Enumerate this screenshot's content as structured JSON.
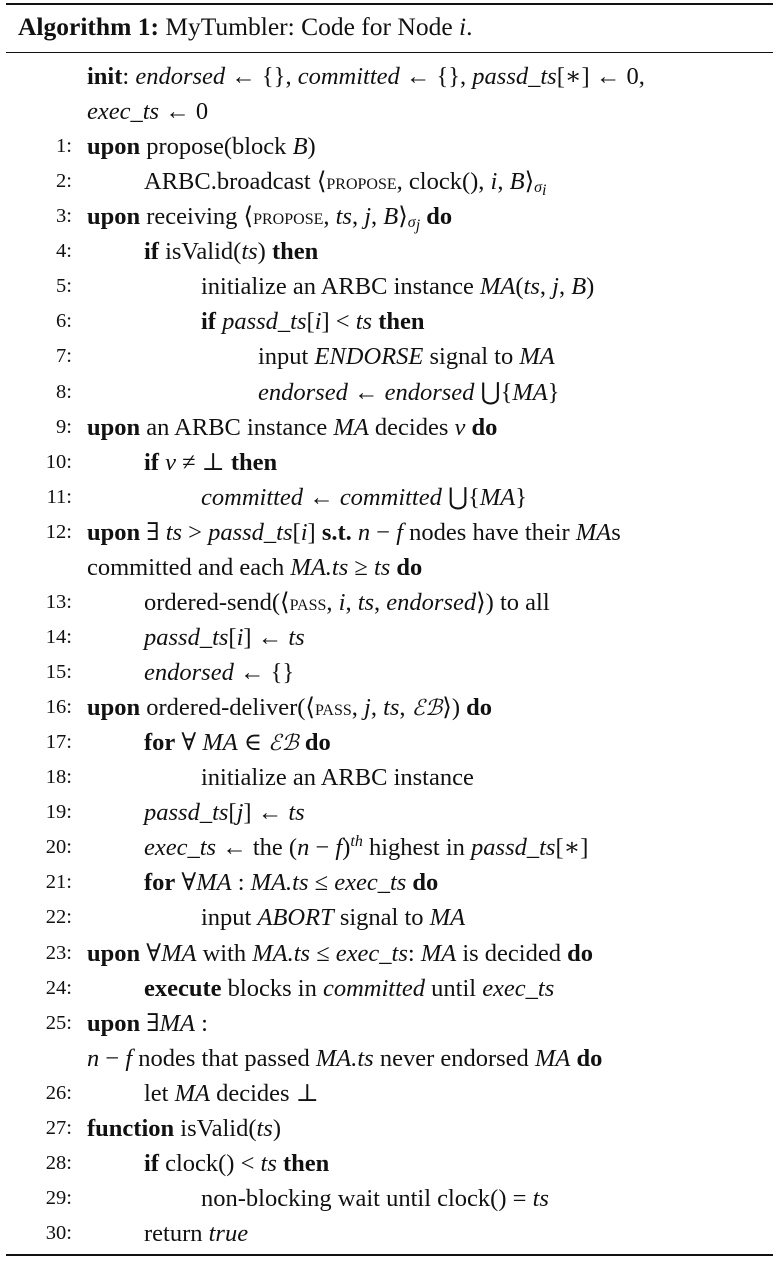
{
  "caption": {
    "label": "Algorithm 1:",
    "title": "MyTumbler: Code for Node i."
  },
  "lines": [
    {
      "num": "",
      "indent": 0,
      "html": "<b>init</b>: <i>endorsed</i> ← {}, <i>committed</i> ← {}, <i>passd_ts</i>[∗] ← 0,"
    },
    {
      "num": "",
      "indent": 0,
      "html": "<i>exec_ts</i> ← 0"
    },
    {
      "num": "1:",
      "indent": 0,
      "html": "<b>upon</b> propose(block <i>B</i>)"
    },
    {
      "num": "2:",
      "indent": 1,
      "html": "ARBC.broadcast ⟨<span class=\"sc\">propose</span>, clock(), <i>i</i>, <i>B</i>⟩<sub><i>σ<sub>i</sub></i></sub>"
    },
    {
      "num": "3:",
      "indent": 0,
      "html": "<b>upon</b> receiving ⟨<span class=\"sc\">propose</span>, <i>ts</i>, <i>j</i>, <i>B</i>⟩<sub><i>σ<sub>j</sub></i></sub> <b>do</b>"
    },
    {
      "num": "4:",
      "indent": 1,
      "html": "<b>if</b> isValid(<i>ts</i>) <b>then</b>"
    },
    {
      "num": "5:",
      "indent": 2,
      "html": "initialize an ARBC instance <i>MA</i>(<i>ts</i>, <i>j</i>, <i>B</i>)"
    },
    {
      "num": "6:",
      "indent": 2,
      "html": "<b>if</b> <i>passd_ts</i>[<i>i</i>] &lt; <i>ts</i> <b>then</b>"
    },
    {
      "num": "7:",
      "indent": 3,
      "html": "input <i>ENDORSE</i> signal to <i>MA</i>"
    },
    {
      "num": "8:",
      "indent": 3,
      "html": "<i>endorsed</i> ← <i>endorsed</i> ⋃{<i>MA</i>}"
    },
    {
      "num": "9:",
      "indent": 0,
      "html": "<b>upon</b> an ARBC instance <i>MA</i> decides <i>v</i> <b>do</b>"
    },
    {
      "num": "10:",
      "indent": 1,
      "html": "<b>if</b> <i>v</i> ≠ ⊥ <b>then</b>"
    },
    {
      "num": "11:",
      "indent": 2,
      "html": "<i>committed</i> ← <i>committed</i> ⋃{<i>MA</i>}"
    },
    {
      "num": "12:",
      "indent": 0,
      "html": "<b>upon</b> ∃ <i>ts</i> &gt; <i>passd_ts</i>[<i>i</i>] <b>s.t.</b> <i>n</i> − <i>f</i> nodes have their <i>MA</i>s"
    },
    {
      "num": "",
      "indent": 0,
      "html": "committed and each <i>MA.ts</i> ≥ <i>ts</i> <b>do</b>"
    },
    {
      "num": "13:",
      "indent": 1,
      "html": "ordered-send(⟨<span class=\"sc\">pass</span>, <i>i</i>, <i>ts</i>, <i>endorsed</i>⟩) to all"
    },
    {
      "num": "14:",
      "indent": 1,
      "html": "<i>passd_ts</i>[<i>i</i>] ← <i>ts</i>"
    },
    {
      "num": "15:",
      "indent": 1,
      "html": "<i>endorsed</i> ← {}"
    },
    {
      "num": "16:",
      "indent": 0,
      "html": "<b>upon</b> ordered-deliver(⟨<span class=\"sc\">pass</span>, <i>j</i>, <i>ts</i>, <span class=\"cal\">ℰℬ</span>⟩) <b>do</b>"
    },
    {
      "num": "17:",
      "indent": 1,
      "html": "<b>for</b> ∀ <i>MA</i> ∈ <span class=\"cal\">ℰℬ</span> <b>do</b>"
    },
    {
      "num": "18:",
      "indent": 2,
      "html": "initialize an ARBC instance"
    },
    {
      "num": "19:",
      "indent": 1,
      "html": "<i>passd_ts</i>[<i>j</i>] ← <i>ts</i>"
    },
    {
      "num": "20:",
      "indent": 1,
      "html": "<i>exec_ts</i> ← the (<i>n</i> − <i>f</i>)<sup><i>th</i></sup> highest in <i>passd_ts</i>[∗]"
    },
    {
      "num": "21:",
      "indent": 1,
      "html": "<b>for</b> ∀<i>MA</i> : <i>MA.ts</i> ≤ <i>exec_ts</i> <b>do</b>"
    },
    {
      "num": "22:",
      "indent": 2,
      "html": "input <i>ABORT</i> signal to <i>MA</i>"
    },
    {
      "num": "23:",
      "indent": 0,
      "html": "<b>upon</b> ∀<i>MA</i> with <i>MA.ts</i> ≤ <i>exec_ts</i>: <i>MA</i> is decided <b>do</b>"
    },
    {
      "num": "24:",
      "indent": 1,
      "html": "<b>execute</b> blocks in <i>committed</i> until <i>exec_ts</i>"
    },
    {
      "num": "25:",
      "indent": 0,
      "html": "<b>upon</b> ∃<i>MA</i> :"
    },
    {
      "num": "",
      "indent": 0,
      "html": "<i>n</i> − <i>f</i> nodes that passed <i>MA.ts</i> never endorsed <i>MA</i> <b>do</b>"
    },
    {
      "num": "26:",
      "indent": 1,
      "html": "let <i>MA</i> decides ⊥"
    },
    {
      "num": "27:",
      "indent": 0,
      "html": "<b>function</b> isValid(<i>ts</i>)"
    },
    {
      "num": "28:",
      "indent": 1,
      "html": "<b>if</b> clock() &lt; <i>ts</i> <b>then</b>"
    },
    {
      "num": "29:",
      "indent": 2,
      "html": "non-blocking wait until clock() = <i>ts</i>"
    },
    {
      "num": "30:",
      "indent": 1,
      "html": "return <i>true</i>"
    }
  ]
}
